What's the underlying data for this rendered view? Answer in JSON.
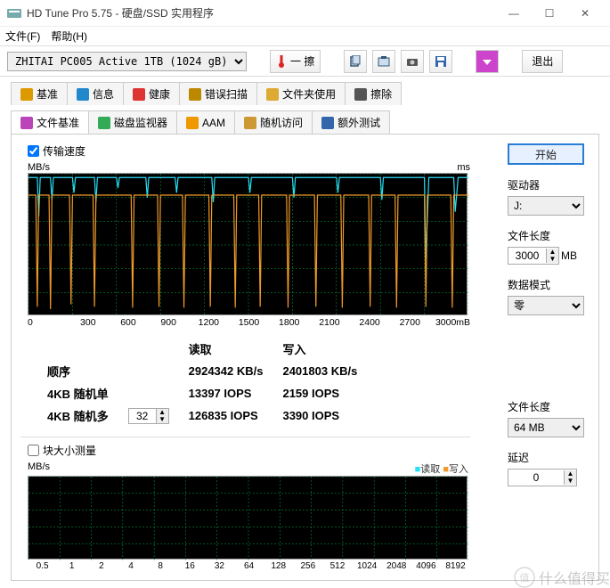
{
  "window": {
    "title": "HD Tune Pro 5.75 - 硬盘/SSD 实用程序",
    "min": "—",
    "max": "☐",
    "close": "✕"
  },
  "menu": {
    "file": "文件(F)",
    "help": "帮助(H)"
  },
  "toolbar": {
    "device": "ZHITAI PC005 Active 1TB (1024 gB)",
    "temp_btn": "一 擦",
    "exit": "退出"
  },
  "tabs": {
    "row1": [
      {
        "label": "基准",
        "icon": "benchmark"
      },
      {
        "label": "信息",
        "icon": "info"
      },
      {
        "label": "健康",
        "icon": "health"
      },
      {
        "label": "错误扫描",
        "icon": "error"
      },
      {
        "label": "文件夹使用",
        "icon": "folder"
      },
      {
        "label": "擦除",
        "icon": "erase"
      }
    ],
    "row2": [
      {
        "label": "文件基准",
        "icon": "filebench",
        "active": true
      },
      {
        "label": "磁盘监视器",
        "icon": "monitor"
      },
      {
        "label": "AAM",
        "icon": "aam"
      },
      {
        "label": "随机访问",
        "icon": "random"
      },
      {
        "label": "额外测试",
        "icon": "extra"
      }
    ]
  },
  "controls": {
    "transfer_speed": "传输速度",
    "block_size": "块大小测量",
    "start": "开始",
    "drive_label": "驱动器",
    "drive": "J:",
    "file_length_label": "文件长度",
    "file_length": "3000",
    "file_length_unit": "MB",
    "data_mode_label": "数据模式",
    "data_mode": "零",
    "file_length2_label": "文件长度",
    "file_length2": "64 MB",
    "delay_label": "延迟",
    "delay": "0"
  },
  "results": {
    "read_hdr": "读取",
    "write_hdr": "写入",
    "seq_label": "顺序",
    "seq_read": "2924342 KB/s",
    "seq_write": "2401803 KB/s",
    "r4k_single_label": "4KB 随机单",
    "r4k_single_read": "13397 IOPS",
    "r4k_single_write": "2159 IOPS",
    "r4k_multi_label": "4KB 随机多",
    "r4k_multi_threads": "32",
    "r4k_multi_read": "126835 IOPS",
    "r4k_multi_write": "3390 IOPS"
  },
  "legend": {
    "read": "读取",
    "write": "写入"
  },
  "watermark": "什么值得买",
  "chart_data": [
    {
      "type": "line",
      "title": "",
      "ylabel": "MB/s",
      "y2label": "ms",
      "ylim": [
        0,
        3000
      ],
      "y2lim": [
        0,
        60
      ],
      "xlim": [
        0,
        3000
      ],
      "xunit": "mB",
      "x_ticks": [
        0,
        300,
        600,
        900,
        1200,
        1500,
        1800,
        2100,
        2400,
        2700,
        3000
      ],
      "y_ticks": [
        500,
        1000,
        1500,
        2000,
        2500,
        3000
      ],
      "y2_ticks": [
        10,
        20,
        30,
        40,
        50,
        60
      ],
      "series": [
        {
          "name": "读取",
          "color": "#26e0f5",
          "values": [
            [
              0,
              2920
            ],
            [
              60,
              2920
            ],
            [
              70,
              2100
            ],
            [
              80,
              2920
            ],
            [
              150,
              2920
            ],
            [
              160,
              2450
            ],
            [
              170,
              2920
            ],
            [
              300,
              2920
            ],
            [
              310,
              2600
            ],
            [
              320,
              2920
            ],
            [
              450,
              2920
            ],
            [
              460,
              2400
            ],
            [
              470,
              2920
            ],
            [
              600,
              2920
            ],
            [
              610,
              2700
            ],
            [
              620,
              2920
            ],
            [
              800,
              2920
            ],
            [
              810,
              2500
            ],
            [
              820,
              2920
            ],
            [
              1000,
              2920
            ],
            [
              1010,
              2600
            ],
            [
              1020,
              2920
            ],
            [
              1250,
              2920
            ],
            [
              1260,
              2400
            ],
            [
              1270,
              2920
            ],
            [
              1500,
              2920
            ],
            [
              1510,
              2600
            ],
            [
              1520,
              2920
            ],
            [
              1800,
              2920
            ],
            [
              1810,
              2500
            ],
            [
              1820,
              2920
            ],
            [
              2100,
              2920
            ],
            [
              2110,
              2600
            ],
            [
              2120,
              2920
            ],
            [
              2400,
              2920
            ],
            [
              2410,
              2450
            ],
            [
              2420,
              2920
            ],
            [
              2700,
              2920
            ],
            [
              2710,
              1200
            ],
            [
              2730,
              2920
            ],
            [
              2900,
              2920
            ],
            [
              2910,
              2200
            ],
            [
              2930,
              2920
            ],
            [
              3000,
              2920
            ]
          ]
        },
        {
          "name": "写入",
          "color": "#f09a2a",
          "values": [
            [
              0,
              2550
            ],
            [
              50,
              2550
            ],
            [
              60,
              200
            ],
            [
              70,
              2550
            ],
            [
              140,
              2550
            ],
            [
              150,
              150
            ],
            [
              160,
              2550
            ],
            [
              280,
              2550
            ],
            [
              290,
              250
            ],
            [
              300,
              2550
            ],
            [
              440,
              2550
            ],
            [
              450,
              200
            ],
            [
              460,
              2550
            ],
            [
              600,
              2550
            ],
            [
              700,
              2550
            ],
            [
              710,
              180
            ],
            [
              720,
              2550
            ],
            [
              880,
              2550
            ],
            [
              890,
              200
            ],
            [
              900,
              2550
            ],
            [
              1050,
              2550
            ],
            [
              1060,
              180
            ],
            [
              1070,
              2550
            ],
            [
              1230,
              2550
            ],
            [
              1240,
              200
            ],
            [
              1250,
              2550
            ],
            [
              1400,
              2550
            ],
            [
              1410,
              180
            ],
            [
              1420,
              2550
            ],
            [
              1570,
              2550
            ],
            [
              1580,
              200
            ],
            [
              1590,
              2550
            ],
            [
              1760,
              2550
            ],
            [
              1770,
              180
            ],
            [
              1780,
              2550
            ],
            [
              1950,
              2550
            ],
            [
              1960,
              200
            ],
            [
              1970,
              2550
            ],
            [
              2130,
              2550
            ],
            [
              2140,
              180
            ],
            [
              2150,
              2550
            ],
            [
              2320,
              2550
            ],
            [
              2330,
              200
            ],
            [
              2340,
              2550
            ],
            [
              2500,
              2550
            ],
            [
              2510,
              180
            ],
            [
              2520,
              2550
            ],
            [
              2700,
              2550
            ],
            [
              2710,
              200
            ],
            [
              2720,
              2550
            ],
            [
              2880,
              2550
            ],
            [
              2890,
              180
            ],
            [
              2900,
              2550
            ],
            [
              3000,
              2550
            ]
          ]
        }
      ]
    },
    {
      "type": "line",
      "ylabel": "MB/s",
      "ylim": [
        0,
        25
      ],
      "y_ticks": [
        5,
        10,
        15,
        20,
        25
      ],
      "x_ticks": [
        0.5,
        1,
        2,
        4,
        8,
        16,
        32,
        64,
        128,
        256,
        512,
        1024,
        2048,
        4096,
        8192
      ],
      "series": []
    }
  ]
}
